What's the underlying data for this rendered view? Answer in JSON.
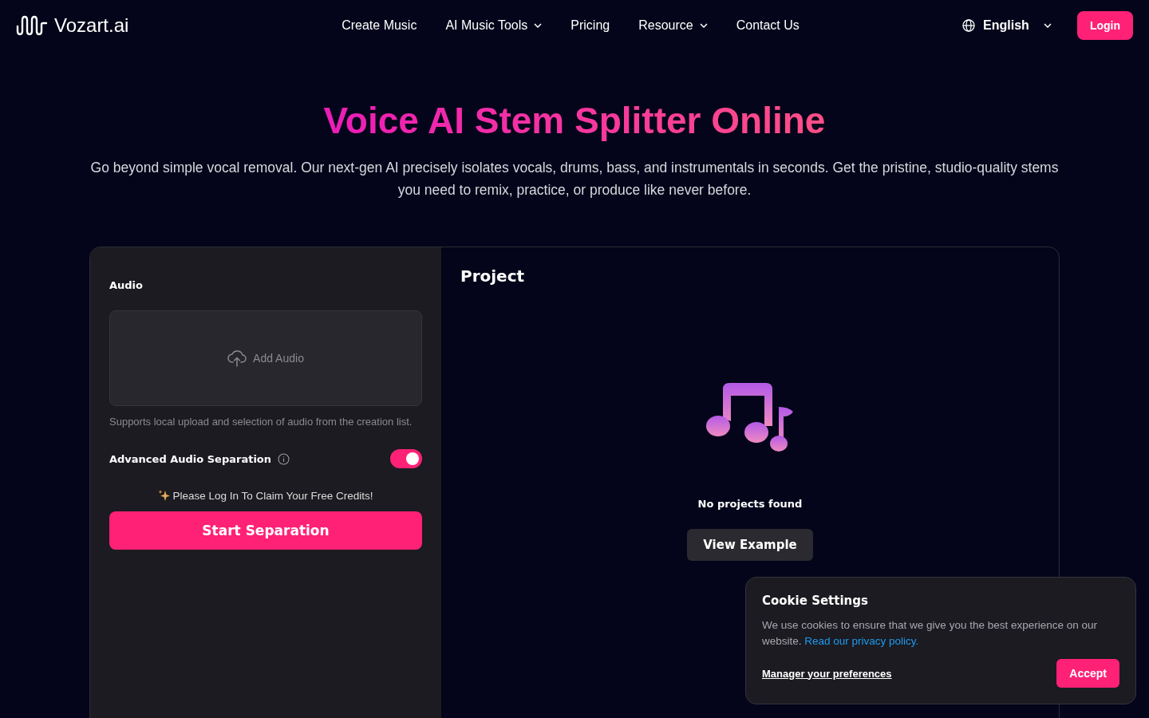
{
  "header": {
    "logo": "Vozart.ai",
    "nav": [
      {
        "label": "Create Music",
        "kind": "link"
      },
      {
        "label": "AI Music Tools",
        "kind": "menu"
      },
      {
        "label": "Pricing",
        "kind": "link"
      },
      {
        "label": "Resource",
        "kind": "menu"
      },
      {
        "label": "Contact Us",
        "kind": "link"
      }
    ],
    "language": "English",
    "login": "Login"
  },
  "hero": {
    "title": "Voice AI Stem Splitter Online",
    "subtitle": "Go beyond simple vocal removal. Our next-gen AI precisely isolates vocals, drums, bass, and instrumentals in seconds. Get the pristine, studio-quality stems you need to remix, practice, or produce like never before."
  },
  "audio_panel": {
    "label": "Audio",
    "upload": "Add Audio",
    "hint": "Supports local upload and selection of audio from the creation list.",
    "advanced": {
      "label": "Advanced Audio Separation",
      "on": true
    },
    "credits_note": "Please Log In To Claim Your Free Credits!",
    "start": "Start Separation"
  },
  "project_panel": {
    "title": "Project",
    "empty": "No projects found",
    "example": "View Example"
  },
  "cookie": {
    "title": "Cookie Settings",
    "text": "We use cookies to ensure that we give you the best experience on our website.",
    "link": "Read our privacy policy.",
    "manage": "Manager your preferences",
    "accept": "Accept"
  }
}
